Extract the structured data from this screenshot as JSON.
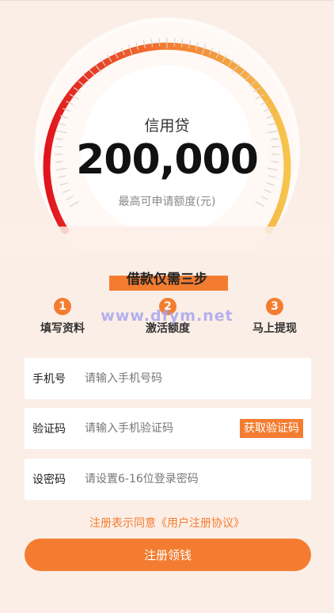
{
  "gauge": {
    "title": "信用贷",
    "amount": "200,000",
    "subtitle": "最高可申请额度(元)",
    "gradient_colors": [
      "#e1141e",
      "#f47c30",
      "#f6c44d"
    ]
  },
  "steps": {
    "title": "借款仅需三步",
    "items": [
      {
        "number": "1",
        "label": "填写资料"
      },
      {
        "number": "2",
        "label": "激活额度"
      },
      {
        "number": "3",
        "label": "马上提现"
      }
    ]
  },
  "watermark": "www.dfym.net",
  "form": {
    "phone": {
      "label": "手机号",
      "placeholder": "请输入手机号码"
    },
    "code": {
      "label": "验证码",
      "placeholder": "请输入手机验证码",
      "button": "获取验证码"
    },
    "password": {
      "label": "设密码",
      "placeholder": "请设置6-16位登录密码"
    }
  },
  "agreement": "注册表示同意《用户注册协议》",
  "submit_label": "注册领钱",
  "colors": {
    "accent": "#f47c30",
    "background": "#fbeee6"
  }
}
